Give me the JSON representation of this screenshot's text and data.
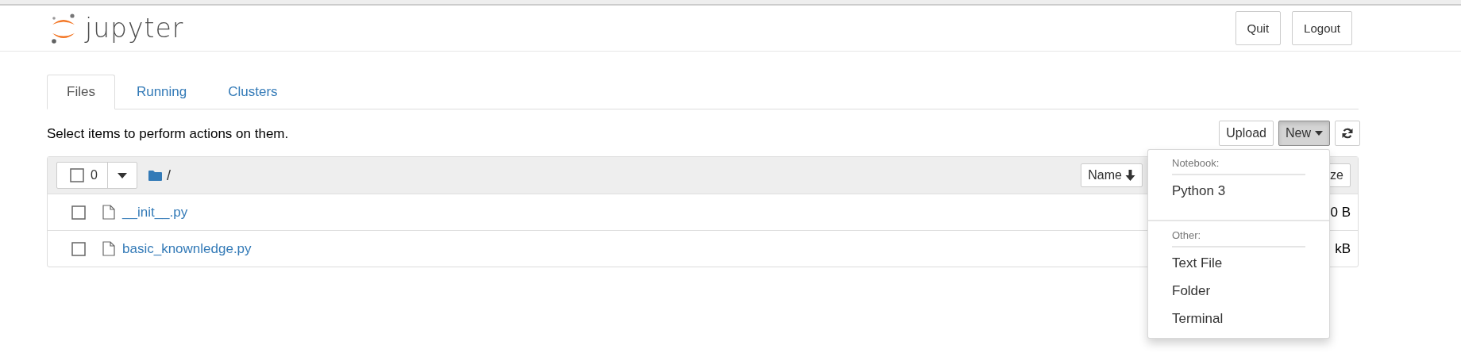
{
  "header": {
    "logo_text": "jupyter",
    "buttons": [
      "Quit",
      "Logout"
    ]
  },
  "tabs": [
    {
      "label": "Files",
      "selected": true
    },
    {
      "label": "Running",
      "selected": false
    },
    {
      "label": "Clusters",
      "selected": false
    }
  ],
  "instructions": "Select items to perform actions on them.",
  "toolbar": [
    {
      "kind": "text",
      "label": "Upload",
      "pressed": false
    },
    {
      "kind": "dropdown",
      "label": "New",
      "pressed": true
    },
    {
      "kind": "refresh",
      "pressed": false
    }
  ],
  "file_list": {
    "selected_count": "0",
    "all_checked": false,
    "path": "/",
    "sort_buttons": [
      {
        "label": "Name",
        "sorted": true
      },
      {
        "label": "ze",
        "sorted": false
      }
    ],
    "rows": [
      {
        "name": "__init__.py",
        "size": "0 B",
        "checked": false
      },
      {
        "name": "basic_knownledge.py",
        "size": "kB",
        "checked": false
      }
    ]
  },
  "new_menu": {
    "open": true,
    "sections": [
      {
        "header": "Notebook:",
        "items": [
          "Python 3"
        ]
      },
      {
        "header": "Other:",
        "items": [
          "Text File",
          "Folder",
          "Terminal"
        ]
      }
    ]
  }
}
